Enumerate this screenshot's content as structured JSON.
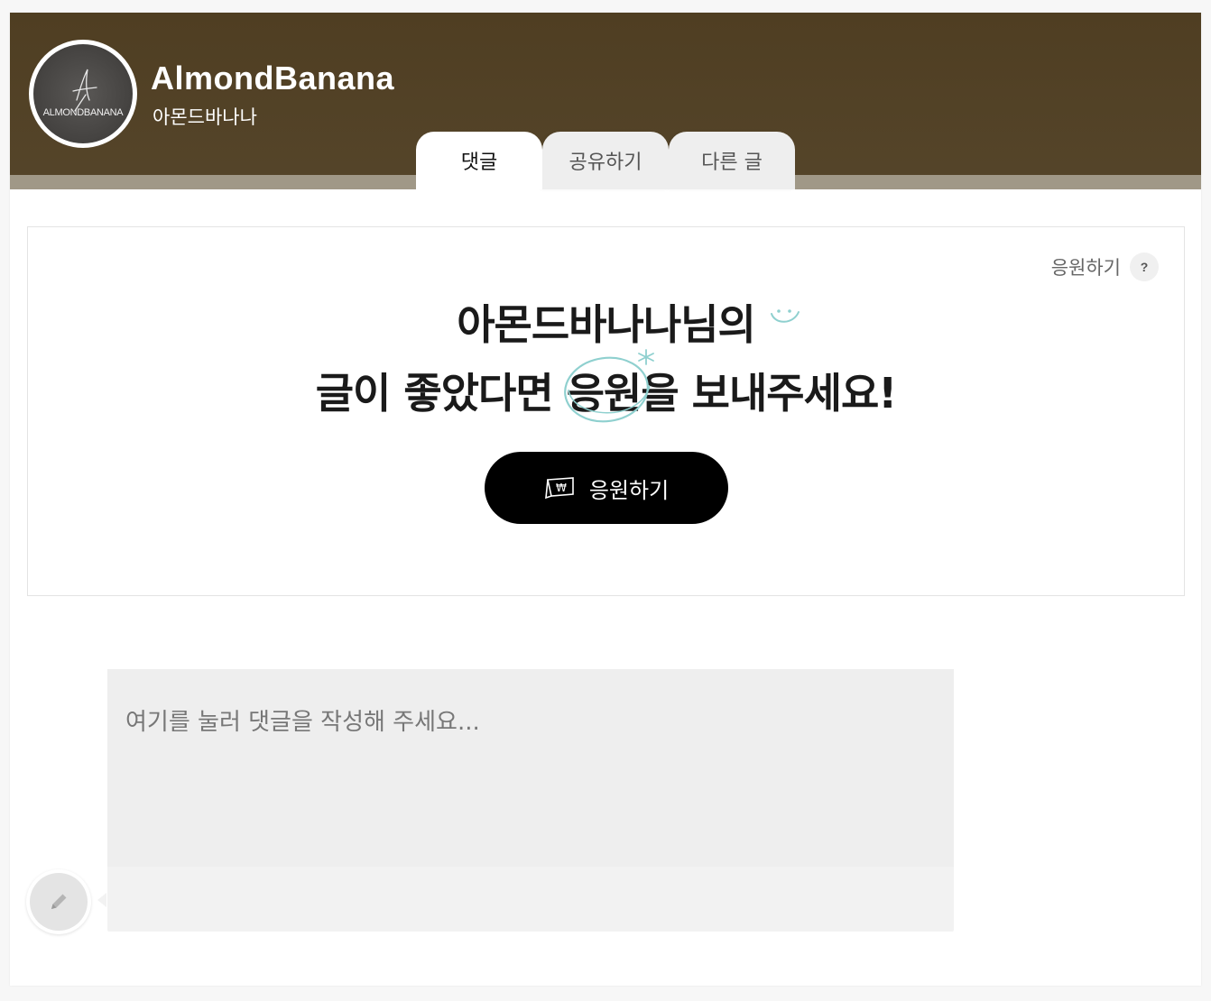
{
  "header": {
    "blog_name": "AlmondBanana",
    "blog_subname": "아몬드바나나",
    "avatar_text": "ALMONDBANANA",
    "background_color": "#4f3e22"
  },
  "tabs": [
    {
      "label": "댓글",
      "active": true
    },
    {
      "label": "공유하기",
      "active": false
    },
    {
      "label": "다른 글",
      "active": false
    }
  ],
  "support": {
    "help_label": "응원하기",
    "help_icon": "?",
    "headline_line1": "아몬드바나나님의",
    "headline_line2_before": "글이 좋았다면 ",
    "headline_line2_highlight": "응원",
    "headline_line2_after": "을 보내주세요!",
    "button_label": "응원하기",
    "accent_color": "#8fd0cf"
  },
  "comment": {
    "placeholder": "여기를 눌러 댓글을 작성해 주세요..."
  }
}
